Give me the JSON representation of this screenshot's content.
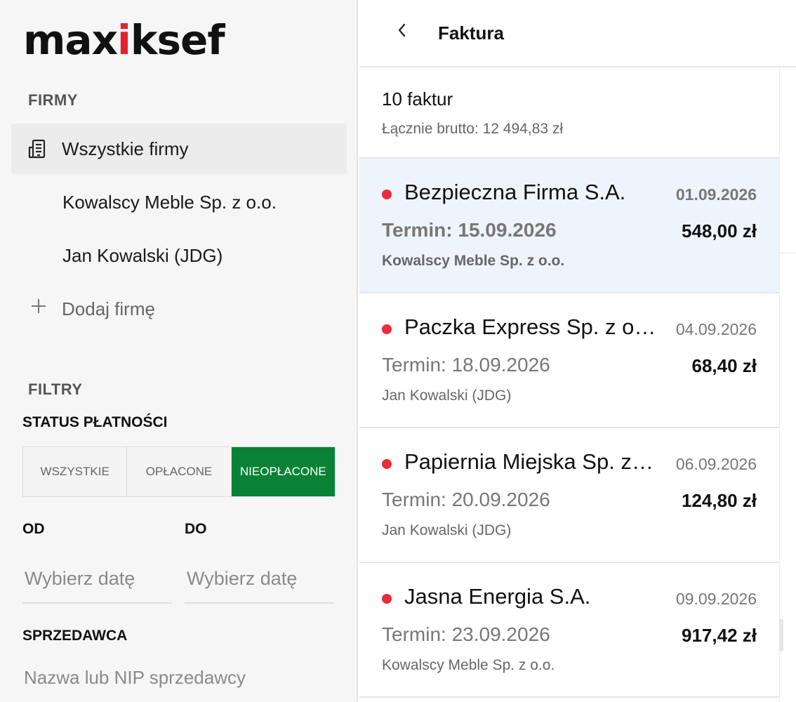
{
  "brand": {
    "logo_prefix": "max",
    "logo_accent": "i",
    "logo_suffix": "ksef"
  },
  "sidebar": {
    "companies_title": "FIRMY",
    "items": [
      {
        "label": "Wszystkie firmy",
        "icon": "building-icon",
        "active": true
      },
      {
        "label": "Kowalscy Meble Sp. z o.o."
      },
      {
        "label": "Jan Kowalski (JDG)"
      }
    ],
    "add_company": "Dodaj firmę",
    "filters_title": "FILTRY",
    "payment_status_label": "STATUS PŁATNOŚCI",
    "payment_status_options": [
      "WSZYSTKIE",
      "OPŁACONE",
      "NIEOPŁACONE"
    ],
    "payment_status_selected": "NIEOPŁACONE",
    "from_label": "OD",
    "to_label": "DO",
    "from_placeholder": "Wybierz datę",
    "to_placeholder": "Wybierz datę",
    "seller_label": "SPRZEDAWCA",
    "seller_placeholder": "Nazwa lub NIP sprzedawcy"
  },
  "header": {
    "back_icon": "chevron-left-icon",
    "title": "Faktura"
  },
  "summary": {
    "count": "10 faktur",
    "total": "Łącznie brutto: 12 494,83 zł"
  },
  "invoices": [
    {
      "name": "Bezpieczna Firma S.A.",
      "date": "01.09.2026",
      "term": "Termin: 15.09.2026",
      "amount": "548,00 zł",
      "company": "Kowalscy Meble Sp. z o.o.",
      "selected": true
    },
    {
      "name": "Paczka Express Sp. z o.o.",
      "date": "04.09.2026",
      "term": "Termin: 18.09.2026",
      "amount": "68,40 zł",
      "company": "Jan Kowalski (JDG)"
    },
    {
      "name": "Papiernia Miejska Sp. z o.o.",
      "date": "06.09.2026",
      "term": "Termin: 20.09.2026",
      "amount": "124,80 zł",
      "company": "Jan Kowalski (JDG)"
    },
    {
      "name": "Jasna Energia S.A.",
      "date": "09.09.2026",
      "term": "Termin: 23.09.2026",
      "amount": "917,42 zł",
      "company": "Kowalscy Meble Sp. z o.o."
    }
  ],
  "colors": {
    "accent_red": "#e0242f",
    "status_dot": "#ea2b3c",
    "active_green": "#0a8236",
    "selected_bg": "#eef4fb"
  }
}
